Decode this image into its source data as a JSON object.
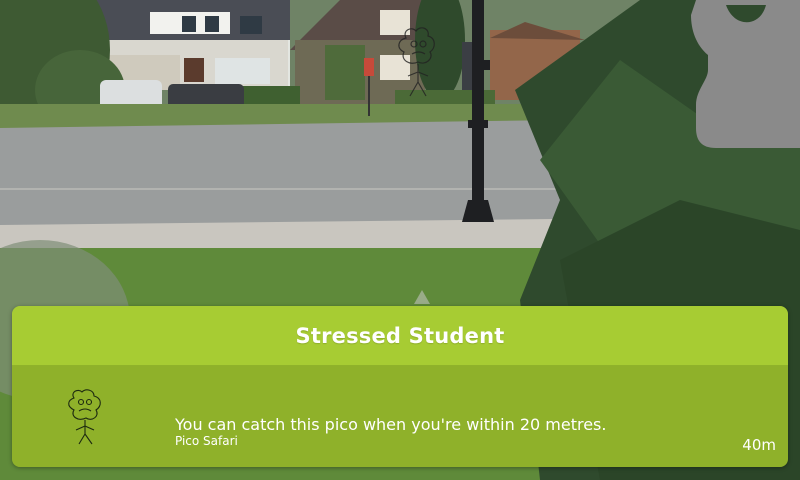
{
  "card": {
    "title": "Stressed Student",
    "message": "You can catch this pico when you're within 20 metres.",
    "source": "Pico Safari",
    "distance": "40m"
  },
  "colors": {
    "header": "#a7cc33",
    "body": "#8fb12a",
    "text": "#ffffff"
  },
  "icons": {
    "pico": "stressed-student-pico-icon",
    "menu": "menu-shape-icon",
    "pointer": "direction-pointer-icon"
  }
}
